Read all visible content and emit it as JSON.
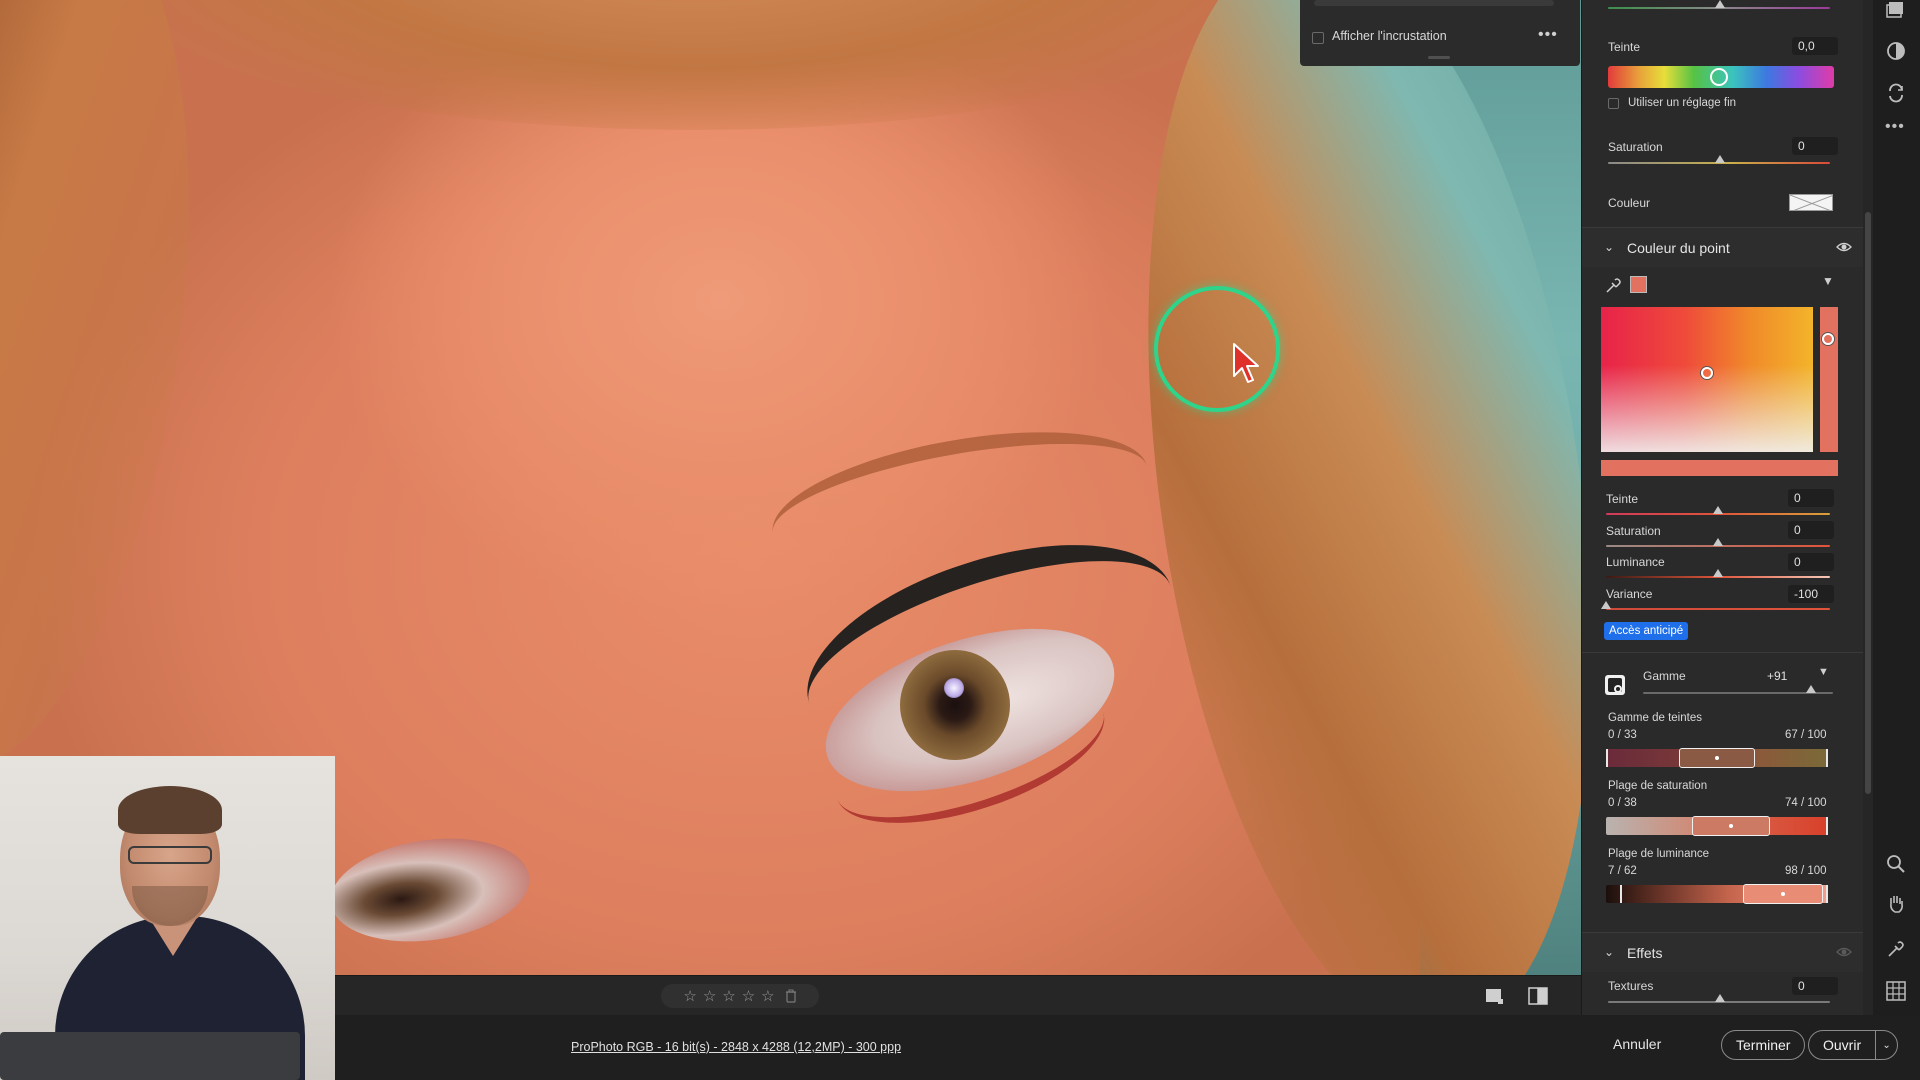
{
  "overlay": {
    "show_overlay_label": "Afficher l'incrustation"
  },
  "panel": {
    "tint_label": "Teinte",
    "tint_value": "0,0",
    "fine_tune_label": "Utiliser un réglage fin",
    "saturation_label": "Saturation",
    "saturation_value": "0",
    "color_label": "Couleur",
    "point_color": {
      "section_title": "Couleur du point",
      "swatch_color": "#e2725f",
      "sliders": [
        {
          "label": "Teinte",
          "value": "0",
          "position": 0.5
        },
        {
          "label": "Saturation",
          "value": "0",
          "position": 0.5
        },
        {
          "label": "Luminance",
          "value": "0",
          "position": 0.5
        },
        {
          "label": "Variance",
          "value": "-100",
          "position": 0.0
        }
      ],
      "early_access_label": "Accès anticipé",
      "range_label": "Gamme",
      "range_value": "+91",
      "hue_range": {
        "label": "Gamme de teintes",
        "left": "0 / 33",
        "right": "67 / 100"
      },
      "saturation_range": {
        "label": "Plage de saturation",
        "left": "0 / 38",
        "right": "74 / 100"
      },
      "luminance_range": {
        "label": "Plage de luminance",
        "left": "7 / 62",
        "right": "98 / 100"
      }
    },
    "effects": {
      "section_title": "Effets",
      "textures_label": "Textures",
      "textures_value": "0"
    }
  },
  "rating": {
    "stars": [
      "☆",
      "☆",
      "☆",
      "☆",
      "☆"
    ]
  },
  "footer": {
    "file_info": "ProPhoto RGB - 16 bit(s) - 2848 x 4288 (12,2MP) - 300 ppp",
    "cancel_label": "Annuler",
    "done_label": "Terminer",
    "open_label": "Ouvrir"
  },
  "colors": {
    "accent": "#1f6feb",
    "cursor_ring": "#2fd48b",
    "cursor_arrow": "#e0302a"
  }
}
